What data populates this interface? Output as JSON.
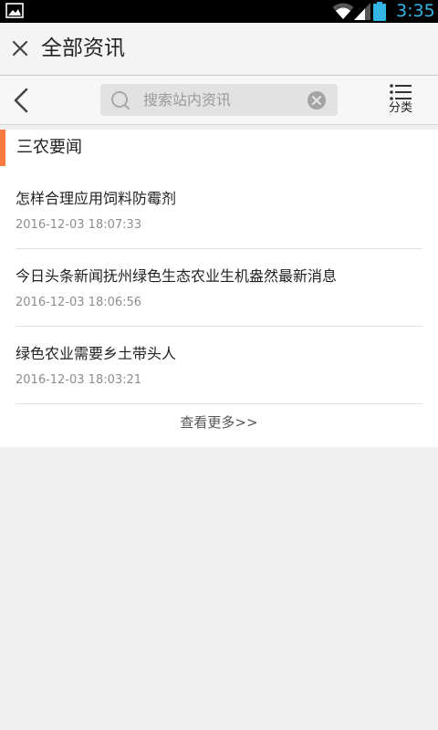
{
  "status_bar": {
    "time": "3:35",
    "icons": [
      "gallery-icon",
      "wifi-icon",
      "signal-icon",
      "battery-icon"
    ],
    "accent_color": "#33b5e5"
  },
  "titlebar": {
    "title": "全部资讯",
    "close_icon": "close-icon"
  },
  "search": {
    "placeholder": "搜索站内资讯",
    "category_label": "分类"
  },
  "section": {
    "title": "三农要闻",
    "accent_color": "#ff7a3d"
  },
  "news": [
    {
      "title": "怎样合理应用饲料防霉剂",
      "time": "2016-12-03 18:07:33"
    },
    {
      "title": "今日头条新闻抚州绿色生态农业生机盎然最新消息",
      "time": "2016-12-03 18:06:56"
    },
    {
      "title": "绿色农业需要乡土带头人",
      "time": "2016-12-03 18:03:21"
    }
  ],
  "more_label": "查看更多>>"
}
